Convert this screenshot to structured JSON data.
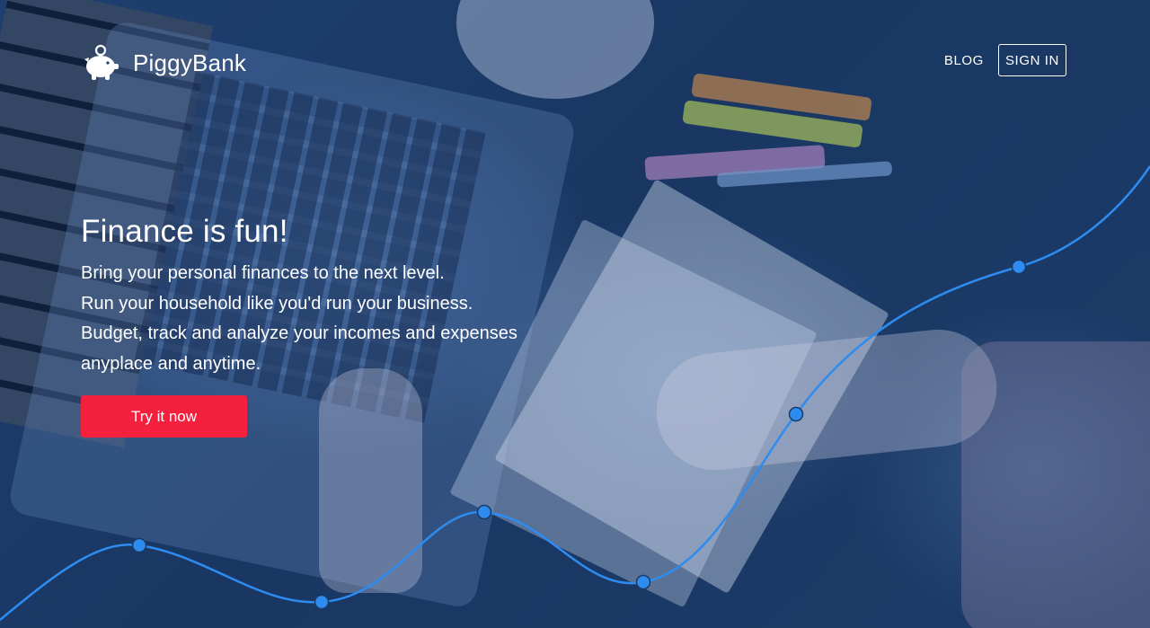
{
  "brand": {
    "name": "PiggyBank",
    "logo_icon": "piggy-bank-icon",
    "accent_color": "#f5203e",
    "curve_color": "#2e8cf0"
  },
  "nav": {
    "blog_label": "BLOG",
    "signin_label": "SIGN IN"
  },
  "hero": {
    "headline": "Finance is fun!",
    "lines": [
      "Bring your personal finances to the next level.",
      "Run your household like you'd run your business.",
      "Budget, track and analyze your incomes and expenses",
      "anyplace and anytime."
    ],
    "cta_label": "Try it now"
  }
}
